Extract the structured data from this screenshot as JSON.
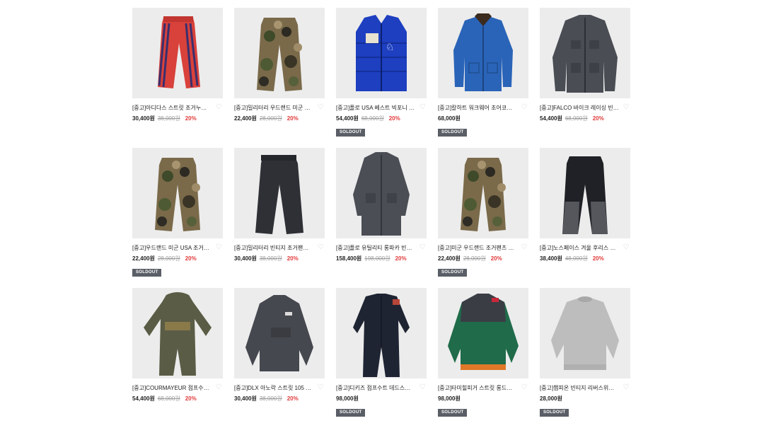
{
  "products": [
    {
      "title": "[중고]아디다스 스트릿 조거누빔 95...",
      "price": "30,400원",
      "original_price": "38,000원",
      "discount": "20%",
      "soldout": "",
      "image": "red-track-pants"
    },
    {
      "title": "[중고]밀리터리 우드랜드 미군 조거...",
      "price": "22,400원",
      "original_price": "28,000원",
      "discount": "20%",
      "soldout": "",
      "image": "camo-pants"
    },
    {
      "title": "[중고]폴로 USA 베스트 빅포니 조...",
      "price": "54,400원",
      "original_price": "68,000원",
      "discount": "20%",
      "soldout": "SOLDOUT",
      "image": "blue-puffer-vest"
    },
    {
      "title": "[중고]칼하트 워크웨어 초어코트 빈...",
      "price": "68,000원",
      "original_price": "",
      "discount": "",
      "soldout": "SOLDOUT",
      "image": "blue-chore-coat"
    },
    {
      "title": "[중고]FALCO 바이크 레이싱 빈티...",
      "price": "54,400원",
      "original_price": "68,000원",
      "discount": "20%",
      "soldout": "",
      "image": "gray-moto-jacket"
    },
    {
      "title": "[중고]우드랜드 미군 USA 조거팬...",
      "price": "22,400원",
      "original_price": "28,000원",
      "discount": "20%",
      "soldout": "SOLDOUT",
      "image": "camo-pants"
    },
    {
      "title": "[중고]밀리터리 빈티지 조거팬츠 S ...",
      "price": "30,400원",
      "original_price": "38,000원",
      "discount": "20%",
      "soldout": "",
      "image": "black-cargo-pants"
    },
    {
      "title": "[중고]폴로 유틸리티 롱파카 빈티지...",
      "price": "158,400원",
      "original_price": "198,000원",
      "discount": "20%",
      "soldout": "",
      "image": "gray-long-parka"
    },
    {
      "title": "[중고]미군 우드랜드 조거팬츠 미군...",
      "price": "22,400원",
      "original_price": "28,000원",
      "discount": "20%",
      "soldout": "SOLDOUT",
      "image": "camo-pants"
    },
    {
      "title": "[중고]노스페이스 겨울 후리스 XL ...",
      "price": "38,400원",
      "original_price": "48,000원",
      "discount": "20%",
      "soldout": "",
      "image": "fleece-pants"
    },
    {
      "title": "[중고]COURMAYEUR 점프수트 ...",
      "price": "54,400원",
      "original_price": "68,000원",
      "discount": "20%",
      "soldout": "",
      "image": "olive-jumpsuit"
    },
    {
      "title": "[중고]DLX 아노락 스트릿 105 남자...",
      "price": "30,400원",
      "original_price": "38,000원",
      "discount": "20%",
      "soldout": "",
      "image": "gray-anorak"
    },
    {
      "title": "[중고]디키즈 점프수트 데드스탁 스...",
      "price": "98,000원",
      "original_price": "",
      "discount": "",
      "soldout": "SOLDOUT",
      "image": "navy-coverall"
    },
    {
      "title": "[중고]타미힐피거 스트릿 롱드스쿨 ...",
      "price": "98,000원",
      "original_price": "",
      "discount": "",
      "soldout": "SOLDOUT",
      "image": "green-ski-jacket"
    },
    {
      "title": "[중고]챔피온 빈티지 리버스위브 S ...",
      "price": "28,000원",
      "original_price": "",
      "discount": "",
      "soldout": "SOLDOUT",
      "image": "gray-sweatshirt"
    }
  ],
  "colors": {
    "discount": "#e23a3a",
    "soldout_badge": "#5a5e66",
    "thumb_bg": "#e9e9e9"
  }
}
